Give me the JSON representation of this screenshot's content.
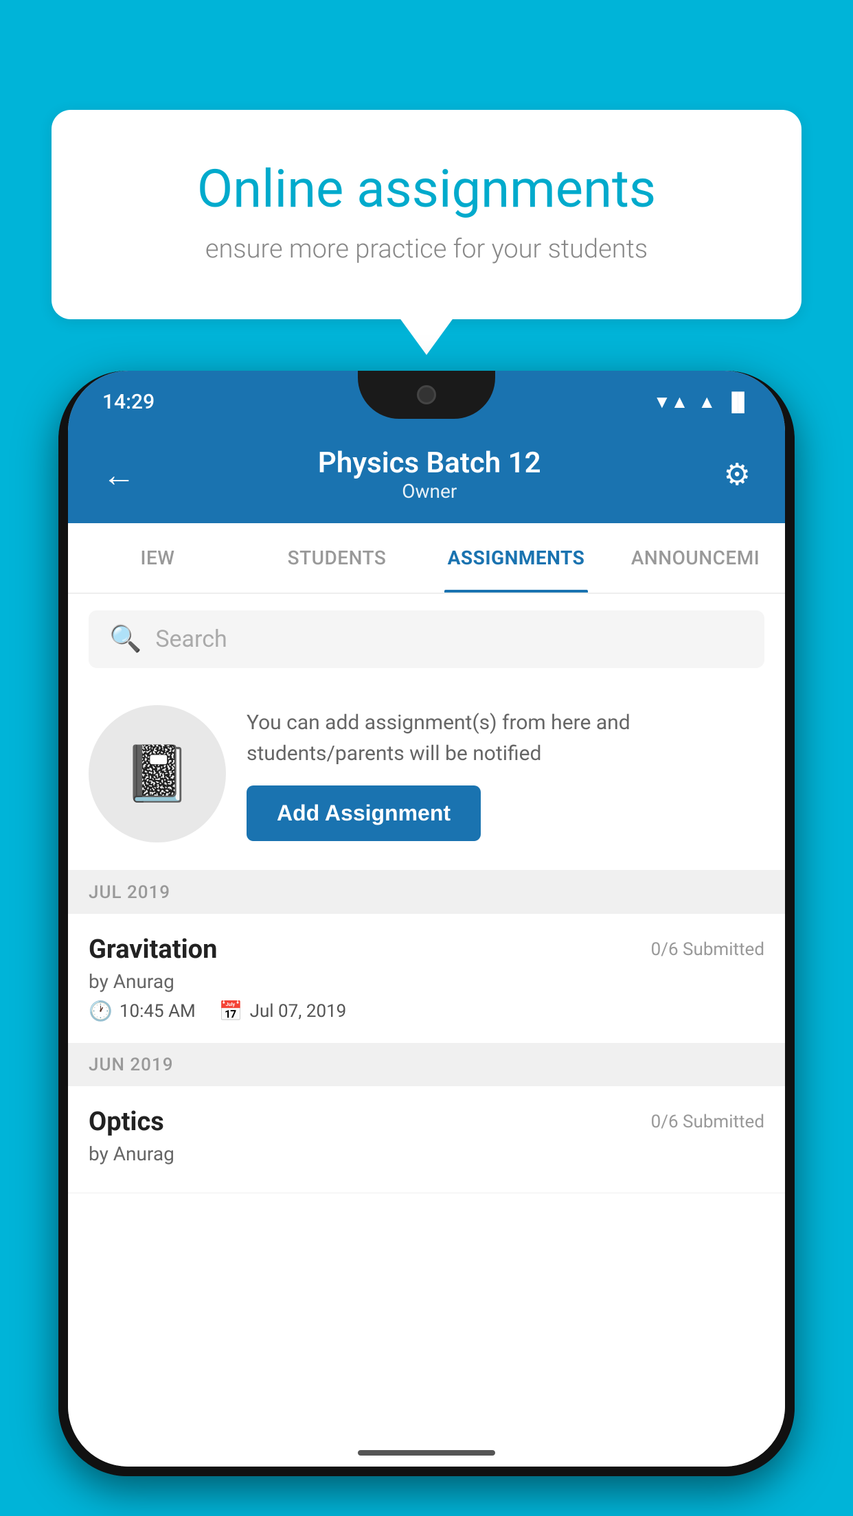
{
  "background_color": "#00b4d8",
  "speech_bubble": {
    "title": "Online assignments",
    "subtitle": "ensure more practice for your students"
  },
  "phone": {
    "status_bar": {
      "time": "14:29",
      "wifi": "▲",
      "signal": "▲",
      "battery": "▐"
    },
    "header": {
      "title": "Physics Batch 12",
      "subtitle": "Owner",
      "back_label": "←",
      "settings_label": "⚙"
    },
    "tabs": [
      {
        "id": "iew",
        "label": "IEW",
        "active": false
      },
      {
        "id": "students",
        "label": "STUDENTS",
        "active": false
      },
      {
        "id": "assignments",
        "label": "ASSIGNMENTS",
        "active": true
      },
      {
        "id": "announcements",
        "label": "ANNOUNCEMI",
        "active": false
      }
    ],
    "search": {
      "placeholder": "Search"
    },
    "promo": {
      "description": "You can add assignment(s) from here and students/parents will be notified",
      "button_label": "Add Assignment"
    },
    "sections": [
      {
        "month": "JUL 2019",
        "assignments": [
          {
            "name": "Gravitation",
            "submitted": "0/6 Submitted",
            "by": "by Anurag",
            "time": "10:45 AM",
            "date": "Jul 07, 2019"
          }
        ]
      },
      {
        "month": "JUN 2019",
        "assignments": [
          {
            "name": "Optics",
            "submitted": "0/6 Submitted",
            "by": "by Anurag",
            "time": "",
            "date": ""
          }
        ]
      }
    ]
  }
}
